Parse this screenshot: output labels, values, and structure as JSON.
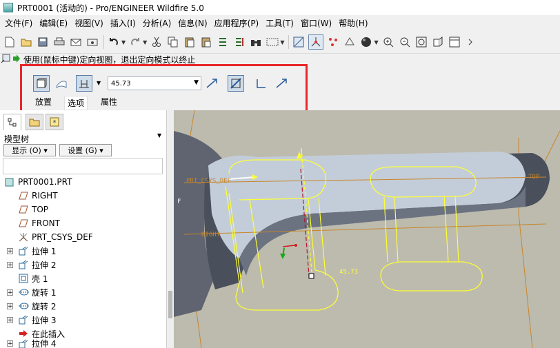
{
  "window": {
    "title": "PRT0001 (活动的) - Pro/ENGINEER Wildfire 5.0"
  },
  "menu": [
    "文件(F)",
    "编辑(E)",
    "视图(V)",
    "插入(I)",
    "分析(A)",
    "信息(N)",
    "应用程序(P)",
    "工具(T)",
    "窗口(W)",
    "帮助(H)"
  ],
  "status": {
    "message": "使用(鼠标中键)定向视图，退出定向模式以终止"
  },
  "dashboard": {
    "depth_value": "45.73",
    "tabs": [
      "放置",
      "选项",
      "属性"
    ]
  },
  "model_tree": {
    "title": "模型树",
    "show_menu": "显示 (O) ▾",
    "settings_menu": "设置 (G) ▾",
    "items": [
      {
        "label": "PRT0001.PRT",
        "icon": "part-icon",
        "expandable": false,
        "indent": 0
      },
      {
        "label": "RIGHT",
        "icon": "datum-plane-icon",
        "expandable": false,
        "indent": 1
      },
      {
        "label": "TOP",
        "icon": "datum-plane-icon",
        "expandable": false,
        "indent": 1
      },
      {
        "label": "FRONT",
        "icon": "datum-plane-icon",
        "expandable": false,
        "indent": 1
      },
      {
        "label": "PRT_CSYS_DEF",
        "icon": "csys-icon",
        "expandable": false,
        "indent": 1
      },
      {
        "label": "拉伸 1",
        "icon": "extrude-icon",
        "expandable": true,
        "indent": 1
      },
      {
        "label": "拉伸 2",
        "icon": "extrude-icon",
        "expandable": true,
        "indent": 1
      },
      {
        "label": "壳 1",
        "icon": "shell-icon",
        "expandable": false,
        "indent": 1
      },
      {
        "label": "旋转 1",
        "icon": "revolve-icon",
        "expandable": true,
        "indent": 1
      },
      {
        "label": "旋转 2",
        "icon": "revolve-icon",
        "expandable": true,
        "indent": 1
      },
      {
        "label": "拉伸 3",
        "icon": "extrude-icon",
        "expandable": true,
        "indent": 1
      },
      {
        "label": "在此插入",
        "icon": "insert-here-arrow-icon",
        "expandable": false,
        "indent": 1
      },
      {
        "label": "拉伸 4",
        "icon": "extrude-icon",
        "expandable": true,
        "indent": 1
      }
    ]
  },
  "viewport": {
    "csys_label": "PRT_CSYS_DEF",
    "top_label": "TOP",
    "right_label": "RIGHT",
    "dimension_label": "45.73"
  },
  "colors": {
    "highlight": "#e8262b",
    "sketch": "#ffff33",
    "datum": "#c8852a",
    "background": "#bdbbae"
  }
}
